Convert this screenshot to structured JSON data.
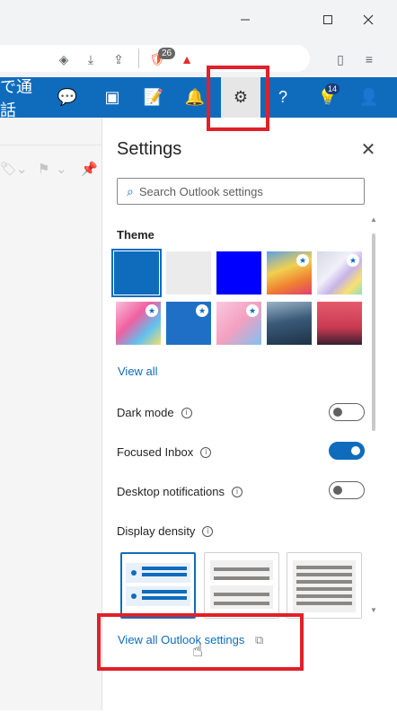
{
  "window": {
    "minimize_icon": "minimize-icon",
    "maximize_icon": "maximize-icon",
    "close_icon": "close-icon"
  },
  "browser": {
    "brave_shields_count": "26"
  },
  "outlook_header": {
    "call_label": "で通話",
    "notification_badge": "14"
  },
  "settings": {
    "title": "Settings",
    "search_placeholder": "Search Outlook settings",
    "theme_label": "Theme",
    "themes": [
      {
        "name": "blue",
        "color": "#0f6cbd",
        "selected": true
      },
      {
        "name": "light-gray",
        "color": "#ebebeb"
      },
      {
        "name": "bright-blue",
        "color": "#0000ff"
      },
      {
        "name": "rainbow",
        "color": "#f0b040",
        "premium": true
      },
      {
        "name": "abstract-light",
        "color": "#e6e6ee",
        "premium": true
      },
      {
        "name": "pink-art",
        "color": "#f472c0",
        "premium": true
      },
      {
        "name": "blue-doodle",
        "color": "#1f6fc6",
        "premium": true
      },
      {
        "name": "pixel-pattern",
        "color": "#f8b4d2",
        "premium": true
      },
      {
        "name": "mountain",
        "color": "#2f4b66"
      },
      {
        "name": "palms",
        "color": "#d9435f"
      }
    ],
    "view_all": "View all",
    "dark_mode": "Dark mode",
    "focused_inbox": "Focused Inbox",
    "desktop_notifications": "Desktop notifications",
    "display_density": "Display density",
    "view_all_outlook_settings": "View all Outlook settings",
    "toggles": {
      "dark_mode": false,
      "focused_inbox": true,
      "desktop_notifications": false
    }
  },
  "colors": {
    "accent": "#0f6cbd",
    "highlight": "#e0202a"
  }
}
